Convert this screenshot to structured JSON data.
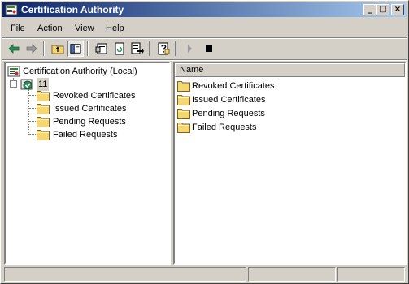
{
  "window": {
    "title": "Certification Authority",
    "controls": {
      "minimize": "_",
      "maximize": "□",
      "close": "×"
    }
  },
  "menu": {
    "items": [
      {
        "label": "File",
        "mnemonic": "F",
        "rest": "ile"
      },
      {
        "label": "Action",
        "mnemonic": "A",
        "rest": "ction"
      },
      {
        "label": "View",
        "mnemonic": "V",
        "rest": "iew"
      },
      {
        "label": "Help",
        "mnemonic": "H",
        "rest": "elp"
      }
    ]
  },
  "toolbar": {
    "buttons": [
      {
        "name": "back-button",
        "icon": "back-arrow-icon"
      },
      {
        "name": "forward-button",
        "icon": "forward-arrow-icon"
      },
      {
        "name": "up-one-level-button",
        "icon": "folder-up-icon"
      },
      {
        "name": "show-hide-console-tree-button",
        "icon": "console-tree-icon",
        "pressed": true
      },
      {
        "name": "properties-button",
        "icon": "properties-icon"
      },
      {
        "name": "refresh-button",
        "icon": "refresh-icon"
      },
      {
        "name": "export-list-button",
        "icon": "export-list-icon"
      },
      {
        "name": "help-button",
        "icon": "help-icon"
      },
      {
        "name": "start-service-button",
        "icon": "play-icon"
      },
      {
        "name": "stop-service-button",
        "icon": "stop-icon"
      }
    ]
  },
  "tree": {
    "root": "Certification Authority (Local)",
    "ca": "11",
    "children": [
      "Revoked Certificates",
      "Issued Certificates",
      "Pending Requests",
      "Failed Requests"
    ]
  },
  "list": {
    "column": "Name",
    "items": [
      "Revoked Certificates",
      "Issued Certificates",
      "Pending Requests",
      "Failed Requests"
    ]
  },
  "colors": {
    "titlebar_start": "#0a246a",
    "titlebar_end": "#a6caf0",
    "face": "#d4d0c8",
    "folder": "#f4d770"
  }
}
